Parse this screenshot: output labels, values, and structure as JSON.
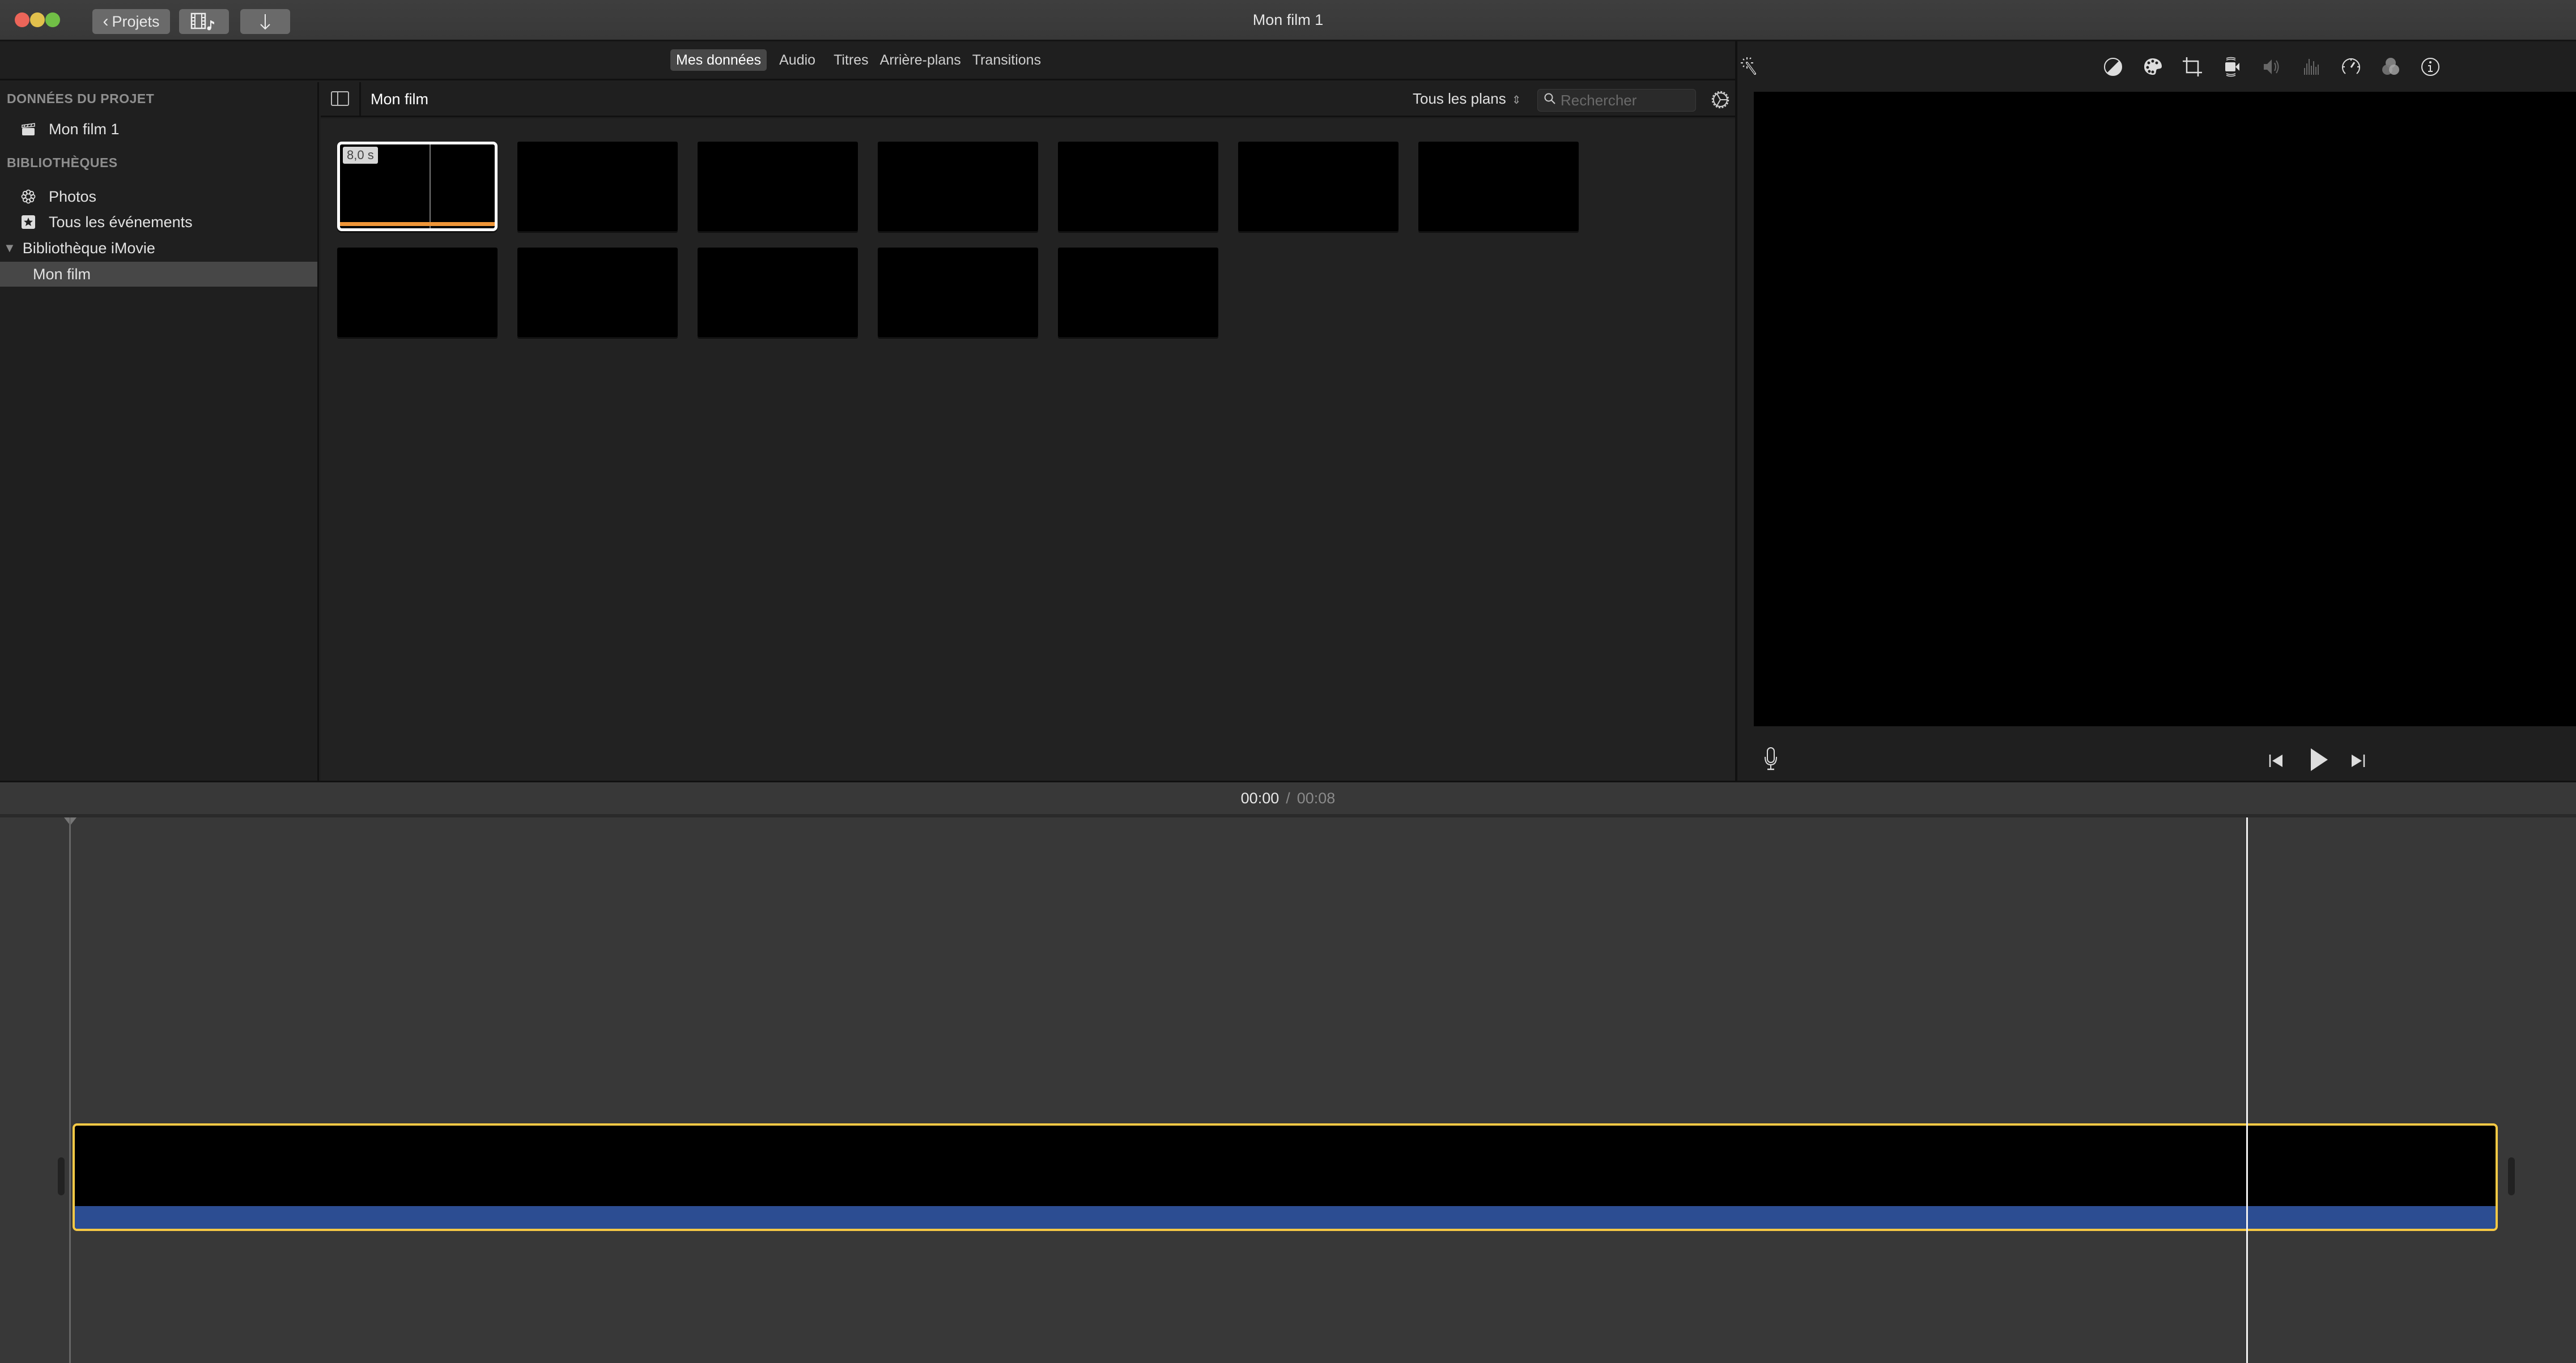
{
  "window": {
    "title": "Mon film 1",
    "back_button": "Projets",
    "media_button_icon": "film-music-icon",
    "import_button_icon": "arrow-down-icon"
  },
  "tabs": [
    {
      "label": "Mes données",
      "active": true
    },
    {
      "label": "Audio",
      "active": false
    },
    {
      "label": "Titres",
      "active": false
    },
    {
      "label": "Arrière-plans",
      "active": false
    },
    {
      "label": "Transitions",
      "active": false
    }
  ],
  "sidebar": {
    "project_header": "DONNÉES DU PROJET",
    "project_item": {
      "label": "Mon film 1",
      "icon": "clapperboard-icon"
    },
    "libraries_header": "BIBLIOTHÈQUES",
    "items": [
      {
        "label": "Photos",
        "icon": "photos-flower-icon"
      },
      {
        "label": "Tous les événements",
        "icon": "star-icon"
      }
    ],
    "library": {
      "label": "Bibliothèque iMovie",
      "expanded": true
    },
    "events": [
      {
        "label": "Mon film",
        "selected": true
      }
    ]
  },
  "browser": {
    "title": "Mon film",
    "filter": "Tous les plans",
    "search_placeholder": "Rechercher",
    "clips": [
      {
        "duration": "8,0 s",
        "selected": true,
        "used": true
      },
      {},
      {},
      {},
      {},
      {},
      {},
      {},
      {},
      {},
      {},
      {}
    ]
  },
  "viewer": {
    "toolbar_icons": [
      "magic-wand-icon",
      "color-balance-icon",
      "color-correction-icon",
      "crop-icon",
      "stabilization-icon",
      "volume-icon",
      "noise-reduction-icon",
      "speed-icon",
      "clip-filter-icon",
      "info-icon"
    ],
    "controls": [
      "microphone-icon",
      "skip-back-icon",
      "play-icon",
      "skip-forward-icon"
    ]
  },
  "timecode": {
    "current": "00:00",
    "separator": "/",
    "total": "00:08"
  },
  "colors": {
    "clip_selection": "#f6c945",
    "audio_track": "#2c4d92",
    "used_marker": "#ef9638"
  }
}
